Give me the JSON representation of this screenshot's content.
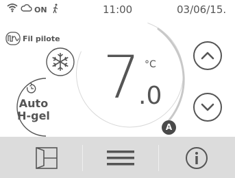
{
  "status": {
    "on_label": "ON",
    "time": "11:00",
    "date": "03/06/15."
  },
  "mode": {
    "pilot_label": "Fil pilote",
    "auto_line1": "Auto",
    "auto_line2": "H-gel"
  },
  "temperature": {
    "integer": "7",
    "decimal": ".0",
    "unit": "°C"
  },
  "badge": "A",
  "colors": {
    "primary": "#555555",
    "bottom_bar": "#dcdcdc",
    "accent_arc": "#c8c8c8"
  },
  "icons": [
    "wifi-icon",
    "cloud-icon",
    "person-walking-icon",
    "pilot-wire-icon",
    "snowflake-icon",
    "refresh-icon",
    "chevron-up-icon",
    "chevron-down-icon",
    "door-icon",
    "menu-icon",
    "info-icon"
  ]
}
